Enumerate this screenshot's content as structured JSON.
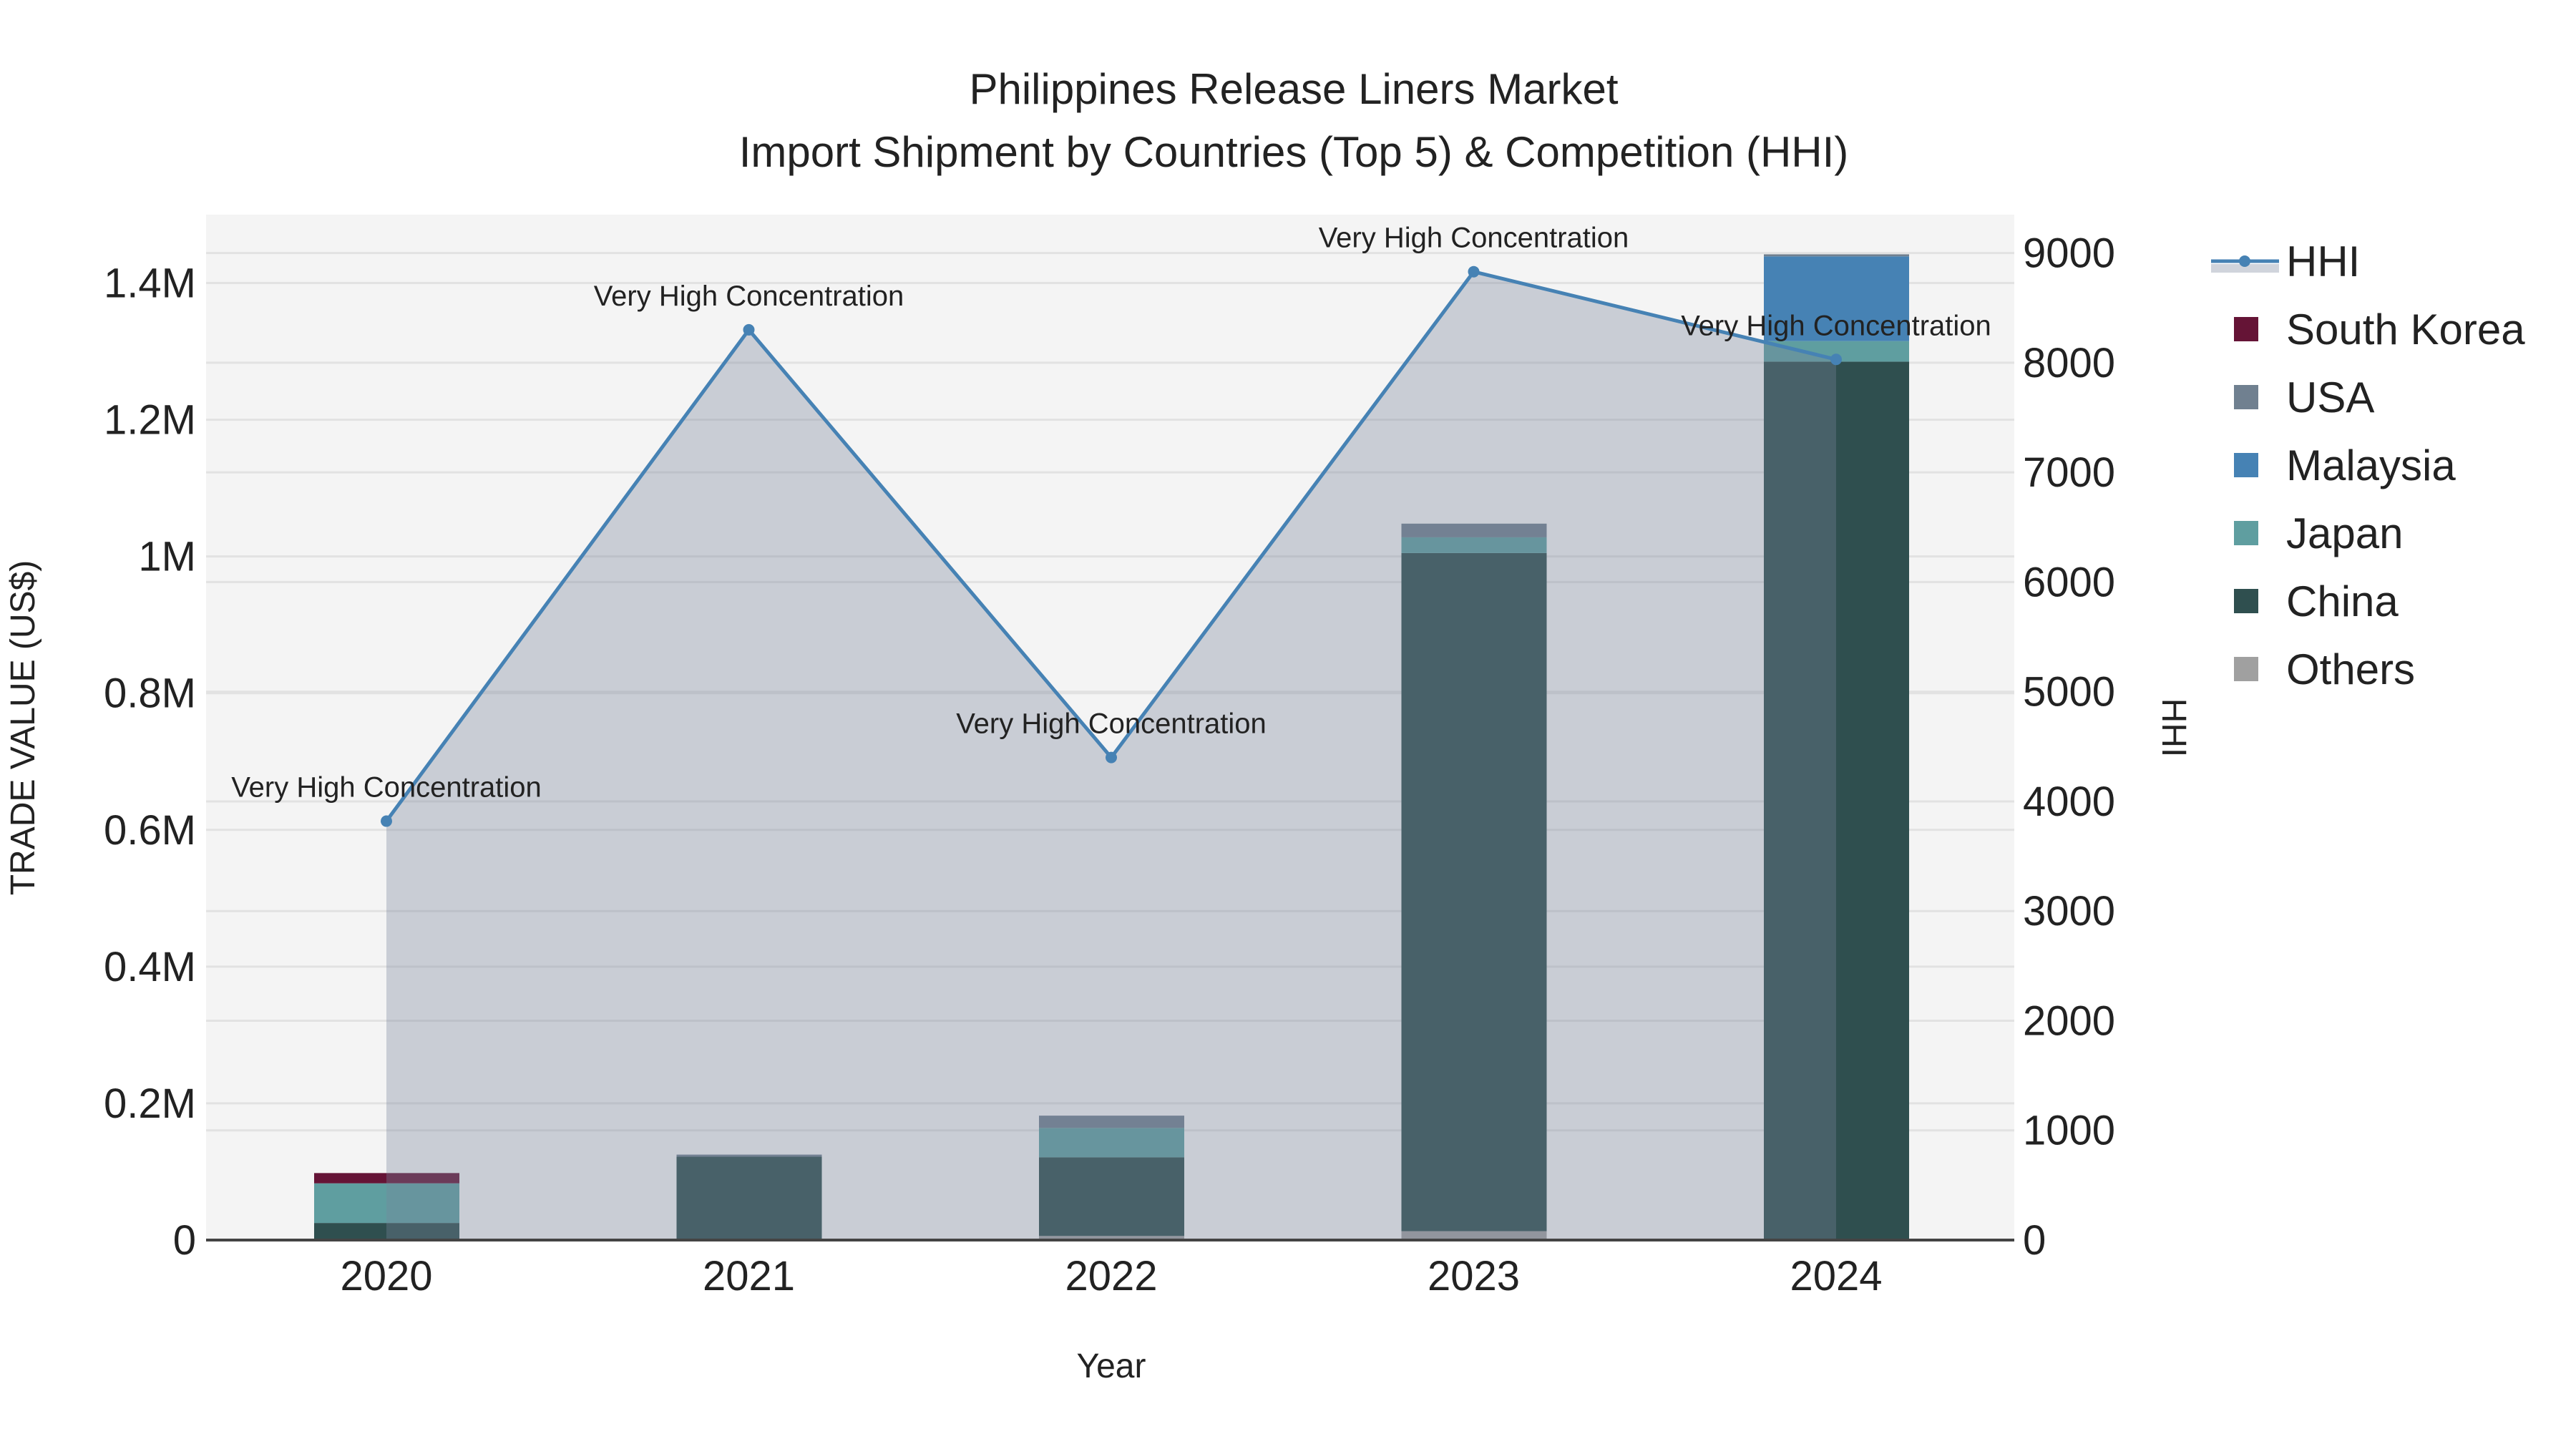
{
  "chart_data": {
    "type": "bar",
    "title": "Philippines Release Liners Market",
    "subtitle": "Import Shipment by Countries (Top 5) & Competition (HHI)",
    "xlabel": "Year",
    "ylabel": "TRADE VALUE (US$)",
    "y2label": "HHI",
    "categories": [
      "2020",
      "2021",
      "2022",
      "2023",
      "2024"
    ],
    "ylim": [
      0,
      1500000
    ],
    "y_ticks": [
      0,
      200000,
      400000,
      600000,
      800000,
      1000000,
      1200000,
      1400000
    ],
    "y_tick_labels": [
      "0",
      "0.2M",
      "0.4M",
      "0.6M",
      "0.8M",
      "1M",
      "1.2M",
      "1.4M"
    ],
    "y2lim": [
      0,
      9350
    ],
    "y2_ticks": [
      0,
      1000,
      2000,
      3000,
      4000,
      5000,
      6000,
      7000,
      8000,
      9000
    ],
    "y2_tick_labels": [
      "0",
      "1000",
      "2000",
      "3000",
      "4000",
      "5000",
      "6000",
      "7000",
      "8000",
      "9000"
    ],
    "stack_order": [
      "Others",
      "China",
      "Japan",
      "Malaysia",
      "USA",
      "South Korea"
    ],
    "series": [
      {
        "name": "South Korea",
        "color": "#651436",
        "values": [
          15000,
          0,
          0,
          0,
          0
        ]
      },
      {
        "name": "USA",
        "color": "#708090",
        "values": [
          0,
          3000,
          18000,
          20000,
          3000
        ]
      },
      {
        "name": "Malaysia",
        "color": "#4682b4",
        "values": [
          0,
          0,
          0,
          0,
          124000
        ]
      },
      {
        "name": "Japan",
        "color": "#5f9ea0",
        "values": [
          58000,
          0,
          43000,
          23000,
          30000
        ]
      },
      {
        "name": "China",
        "color": "#2f4f4f",
        "values": [
          25000,
          122000,
          115000,
          992000,
          1285000
        ]
      },
      {
        "name": "Others",
        "color": "#a0a0a0",
        "values": [
          0,
          0,
          6000,
          13000,
          0
        ]
      }
    ],
    "hhi": {
      "name": "HHI",
      "color": "#4682b4",
      "values": [
        3820,
        8300,
        4400,
        8830,
        8030
      ],
      "annotations": [
        "Very High Concentration",
        "Very High Concentration",
        "Very High Concentration",
        "Very High Concentration",
        "Very High Concentration"
      ]
    },
    "legend": [
      "HHI",
      "South Korea",
      "USA",
      "Malaysia",
      "Japan",
      "China",
      "Others"
    ],
    "legend_position": "right",
    "grid": true
  }
}
